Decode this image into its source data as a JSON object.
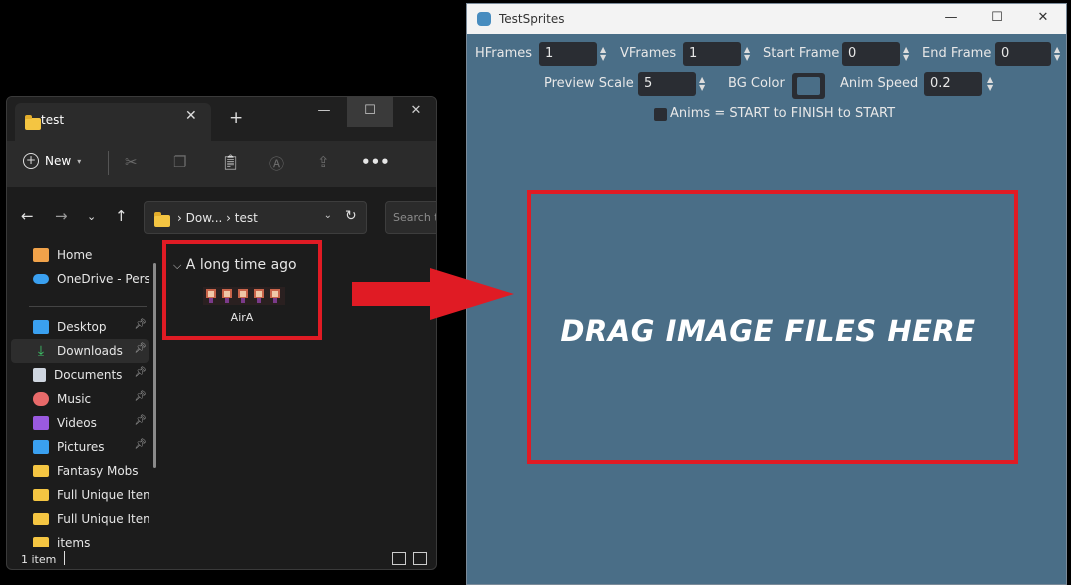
{
  "explorer": {
    "tab_title": "test",
    "toolbar": {
      "new_label": "New"
    },
    "address": {
      "path": "Dow...  ›  test",
      "search_placeholder": "Search te"
    },
    "sidebar": {
      "items": [
        {
          "label": "Home",
          "icon": "home-icon",
          "color": "#f0a24a"
        },
        {
          "label": "OneDrive - Personal",
          "icon": "cloud-icon",
          "color": "#3aa0f0"
        },
        {
          "label": "Desktop",
          "icon": "desktop-icon",
          "color": "#3aa0f0",
          "pinned": true
        },
        {
          "label": "Downloads",
          "icon": "download-icon",
          "color": "#3ec96a",
          "pinned": true,
          "selected": true
        },
        {
          "label": "Documents",
          "icon": "document-icon",
          "color": "#cfd6e0",
          "pinned": true
        },
        {
          "label": "Music",
          "icon": "music-icon",
          "color": "#e86a6a",
          "pinned": true
        },
        {
          "label": "Videos",
          "icon": "video-icon",
          "color": "#9a5ae0",
          "pinned": true
        },
        {
          "label": "Pictures",
          "icon": "pictures-icon",
          "color": "#3aa0f0",
          "pinned": true
        },
        {
          "label": "Fantasy Mobs",
          "icon": "folder-icon",
          "color": "#f4c542"
        },
        {
          "label": "Full Unique Item Sprites",
          "icon": "folder-icon",
          "color": "#f4c542"
        },
        {
          "label": "Full Unique Item Sprites",
          "icon": "folder-icon",
          "color": "#f4c542"
        },
        {
          "label": "items",
          "icon": "folder-icon",
          "color": "#f4c542"
        }
      ]
    },
    "content": {
      "group_header": "A long time ago",
      "file": {
        "name": "AirA"
      }
    },
    "status": {
      "count": "1 item"
    }
  },
  "godot": {
    "title": "TestSprites",
    "hframes": {
      "label": "HFrames",
      "value": "1"
    },
    "vframes": {
      "label": "VFrames",
      "value": "1"
    },
    "start_frame": {
      "label": "Start Frame",
      "value": "0"
    },
    "end_frame": {
      "label": "End Frame",
      "value": "0"
    },
    "preview_scale": {
      "label": "Preview Scale",
      "value": "5"
    },
    "bg_color": {
      "label": "BG Color",
      "color": "#4a6e87"
    },
    "anim_speed": {
      "label": "Anim Speed",
      "value": "0.2"
    },
    "anims_checkbox": {
      "label": "Anims = START to FINISH to START",
      "checked": false
    },
    "drop_zone_text": "DRAG IMAGE FILES HERE"
  },
  "colors": {
    "highlight": "#e01b24",
    "godot_bg": "#4a6e87",
    "explorer_bg": "#1c1c1c"
  }
}
